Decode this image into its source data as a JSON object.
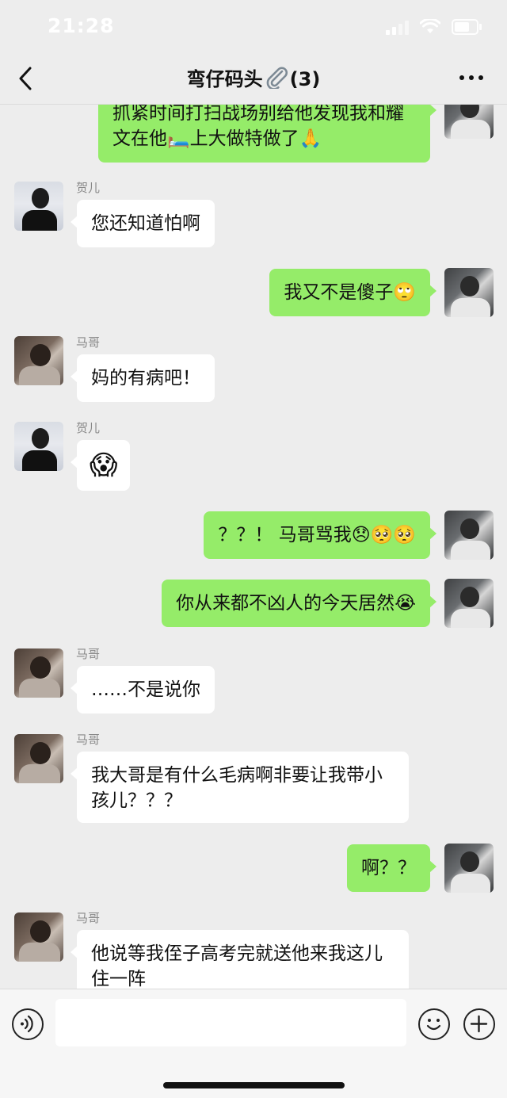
{
  "status_bar": {
    "time": "21:28"
  },
  "header": {
    "title_part1": "弯仔码头",
    "title_part2": "(3)",
    "clip_icon": "paperclip-icon"
  },
  "messages": [
    {
      "text": "抓紧时间打扫战场别给他发现我和耀文在他🛏️上大做特做了🙏"
    },
    {
      "sender": "贺儿",
      "text": "您还知道怕啊"
    },
    {
      "text": "我又不是傻子🙄"
    },
    {
      "sender": "马哥",
      "text": "妈的有病吧！"
    },
    {
      "sender": "贺儿",
      "text": "😱"
    },
    {
      "text": "？？！ 马哥骂我😞🥺🥺"
    },
    {
      "text": "你从来都不凶人的今天居然😭"
    },
    {
      "sender": "马哥",
      "text": "……不是说你"
    },
    {
      "sender": "马哥",
      "text": "我大哥是有什么毛病啊非要让我带小孩儿？？？"
    },
    {
      "text": "啊？？"
    },
    {
      "sender": "马哥",
      "text": "他说等我侄子高考完就送他来我这儿住一阵"
    }
  ],
  "input": {
    "value": ""
  },
  "colors": {
    "background": "#ededed",
    "outgoing_bubble": "#95ec69",
    "incoming_bubble": "#ffffff"
  }
}
